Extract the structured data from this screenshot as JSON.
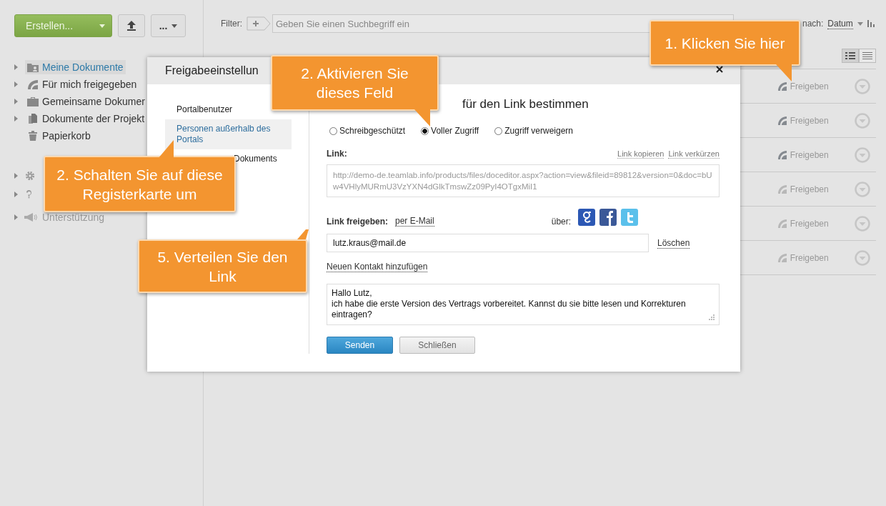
{
  "toolbar": {
    "create_button": "Erstellen...",
    "more_button": "..."
  },
  "sidebar": {
    "items": [
      {
        "kind": "my_documents",
        "label": "Meine Dokumente",
        "selected": true,
        "expandable": true
      },
      {
        "kind": "shared_with_me",
        "label": "Für mich freigegeben",
        "selected": false,
        "expandable": true
      },
      {
        "kind": "common",
        "label": "Gemeinsame Dokumer",
        "selected": false,
        "expandable": true
      },
      {
        "kind": "projects",
        "label": "Dokumente der Projekt",
        "selected": false,
        "expandable": true
      },
      {
        "kind": "trash",
        "label": "Papierkorb",
        "selected": false,
        "expandable": false
      }
    ],
    "bottom_items": [
      {
        "kind": "settings",
        "expandable": true
      },
      {
        "kind": "help",
        "expandable": true
      },
      {
        "kind": "support",
        "label": "Unterstützung",
        "expandable": true
      }
    ]
  },
  "filter": {
    "label": "Filter:",
    "placeholder": "Geben Sie einen Suchbegriff ein"
  },
  "sort": {
    "label": "nach:",
    "value": "Datum"
  },
  "view_modes": [
    {
      "kind": "details",
      "selected": true
    },
    {
      "kind": "list",
      "selected": false
    }
  ],
  "rows": [
    {
      "action": "Freigeben",
      "enabled": true
    },
    {
      "action": "Freigeben",
      "enabled": true
    },
    {
      "action": "Freigeben",
      "enabled": true
    },
    {
      "action": "Freigeben",
      "enabled": false
    },
    {
      "action": "Freigeben",
      "enabled": false
    },
    {
      "action": "Freigeben",
      "enabled": false
    }
  ],
  "dialog": {
    "title": "Freigabeeinstellun",
    "tabs": [
      {
        "label": "Portalbenutzer",
        "selected": false
      },
      {
        "label": "Personen außerhalb des Portals",
        "selected": true
      },
      {
        "label": "Dokuments",
        "selected": false
      }
    ],
    "heading": "für den Link bestimmen",
    "access_options": [
      {
        "label": "Schreibgeschützt",
        "selected": false
      },
      {
        "label": "Voller Zugriff",
        "selected": true
      },
      {
        "label": "Zugriff verweigern",
        "selected": false
      }
    ],
    "link_label": "Link:",
    "link_actions": [
      "Link kopieren",
      "Link verkürzen"
    ],
    "link_url": "http://demo-de.teamlab.info/products/files/doceditor.aspx?action=view&fileid=89812&version=0&doc=bUw4VHlyMURmU3VzYXN4dGlkTmswZz09PyI4OTgxMiI1",
    "share_label": "Link freigeben:",
    "share_email": "per E-Mail",
    "share_via": "über:",
    "social": [
      {
        "kind": "google"
      },
      {
        "kind": "facebook"
      },
      {
        "kind": "twitter"
      }
    ],
    "recipients": [
      {
        "email": "lutz.kraus@mail.de",
        "remove": "Löschen"
      }
    ],
    "add_contact": "Neuen Kontakt hinzufügen",
    "message": "Hallo Lutz,\nich habe die erste Version des Vertrags vorbereitet. Kannst du sie bitte lesen und Korrekturen eintragen?",
    "buttons": [
      {
        "label": "Senden",
        "kind": "primary"
      },
      {
        "label": "Schließen",
        "kind": "secondary"
      }
    ]
  },
  "callouts": [
    {
      "text": "1. Klicken Sie hier"
    },
    {
      "text": "2. Aktivieren Sie dieses Feld"
    },
    {
      "text": "2. Schalten Sie auf diese Registerkarte um"
    },
    {
      "text": "5. Verteilen Sie den Link"
    }
  ]
}
